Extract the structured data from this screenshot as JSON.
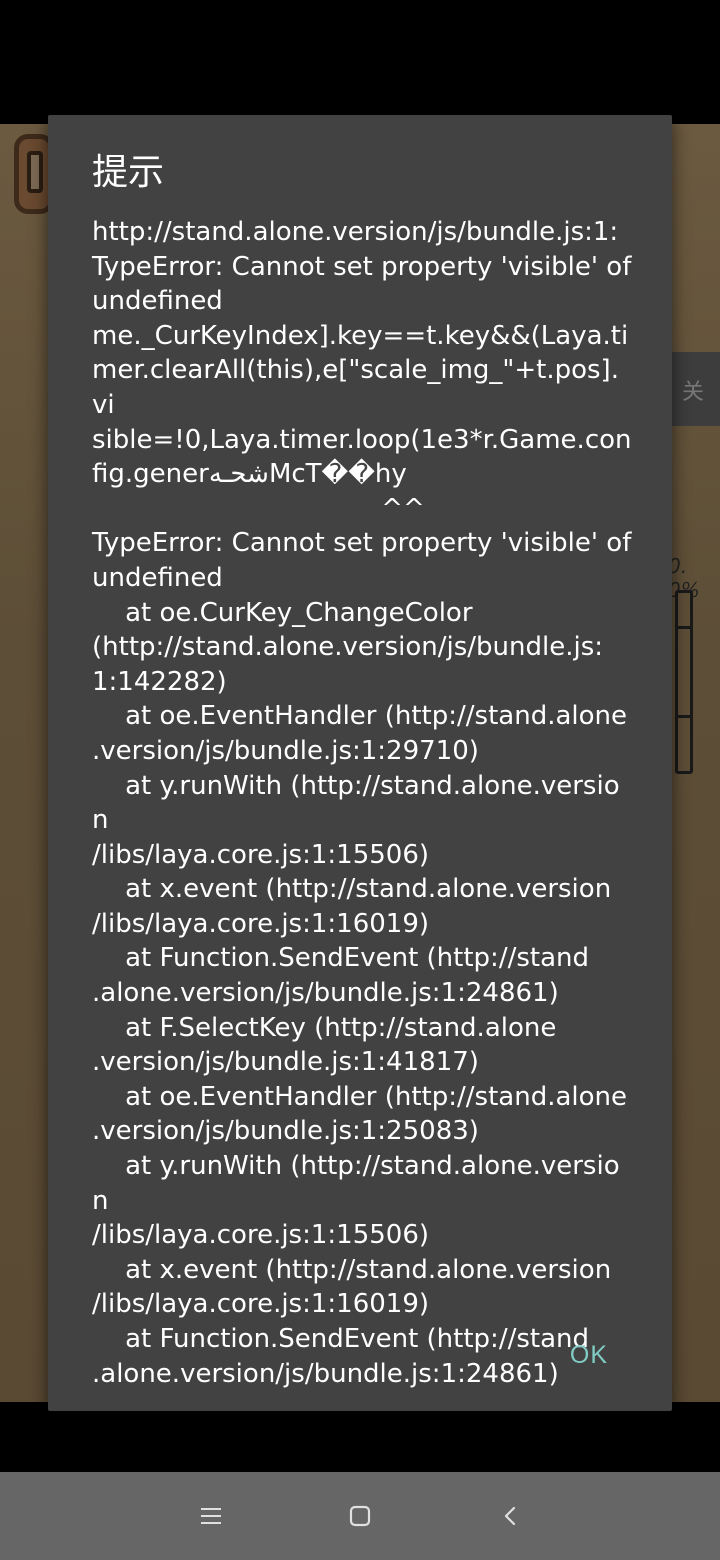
{
  "dialog": {
    "title": "提示",
    "message_lines": [
      "http://stand.alone.version/js/bundle.js:1:",
      "TypeError: Cannot set property 'visible' of",
      "undefined",
      "me._CurKeyIndex].key==t.key&&(Laya.ti",
      "mer.clearAll(this),e[\"scale_img_\"+t.pos].vi",
      "sible=!0,Laya.timer.loop(1e3*r.Game.con",
      "fig.generشحـﻪMcT��hy",
      "                                   ^^",
      "TypeError: Cannot set property 'visible' of",
      "undefined",
      "    at oe.CurKey_ChangeColor",
      "(http://stand.alone.version/js/bundle.js:",
      "1:142282)",
      "    at oe.EventHandler (http://stand.alone",
      ".version/js/bundle.js:1:29710)",
      "    at y.runWith (http://stand.alone.version",
      "/libs/laya.core.js:1:15506)",
      "    at x.event (http://stand.alone.version",
      "/libs/laya.core.js:1:16019)",
      "    at Function.SendEvent (http://stand",
      ".alone.version/js/bundle.js:1:24861)",
      "    at F.SelectKey (http://stand.alone",
      ".version/js/bundle.js:1:41817)",
      "    at oe.EventHandler (http://stand.alone",
      ".version/js/bundle.js:1:25083)",
      "    at y.runWith (http://stand.alone.version",
      "/libs/laya.core.js:1:15506)",
      "    at x.event (http://stand.alone.version",
      "/libs/laya.core.js:1:16019)",
      "    at Function.SendEvent (http://stand",
      ".alone.version/js/bundle.js:1:24861)"
    ],
    "ok_label": "OK",
    "accent_color": "#80cbc4"
  },
  "background": {
    "percent_label": "0. 0%",
    "side_tab_label": "关"
  },
  "nav_bar": {
    "menu_icon": "menu-icon",
    "home_icon": "home-icon",
    "back_icon": "back-icon"
  }
}
